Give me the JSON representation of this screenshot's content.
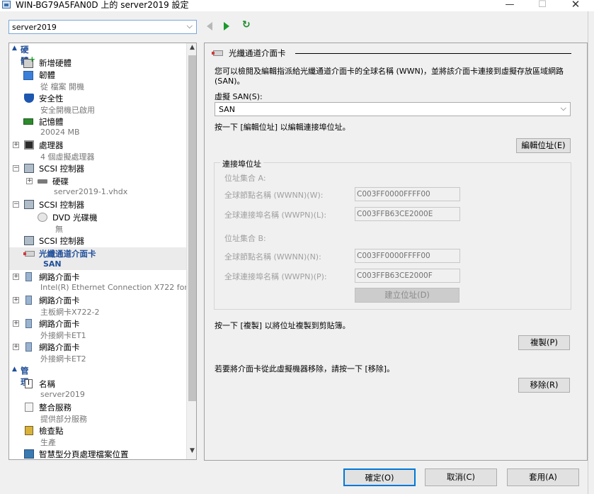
{
  "window": {
    "title": "WIN-BG79A5FAN0D 上的 server2019 設定",
    "min_glyph": "—",
    "max_glyph": "☐",
    "close_glyph": "✕"
  },
  "vm_select": {
    "value": "server2019",
    "arrow": "⌵"
  },
  "toolbar": {
    "back_icon": "back-arrow-icon",
    "forward_icon": "forward-arrow-icon",
    "refresh_glyph": "↻"
  },
  "tree": {
    "sections": {
      "hardware": "硬體",
      "management": "管理"
    },
    "items": [
      {
        "label": "新增硬體",
        "sub": ""
      },
      {
        "label": "韌體",
        "sub": "從 檔案 開機"
      },
      {
        "label": "安全性",
        "sub": "安全開機已啟用"
      },
      {
        "label": "記憶體",
        "sub": "20024 MB"
      },
      {
        "label": "處理器",
        "sub": "4 個虛擬處理器"
      },
      {
        "label": "SCSI 控制器",
        "sub": ""
      },
      {
        "label": "硬碟",
        "sub": "server2019-1.vhdx"
      },
      {
        "label": "SCSI 控制器",
        "sub": ""
      },
      {
        "label": "DVD 光碟機",
        "sub": "無"
      },
      {
        "label": "SCSI 控制器",
        "sub": ""
      },
      {
        "label": "光纖通道介面卡",
        "sub": "SAN"
      },
      {
        "label": "網路介面卡",
        "sub": "Intel(R) Ethernet Connection X722 for ..."
      },
      {
        "label": "網路介面卡",
        "sub": "主板網卡X722-2"
      },
      {
        "label": "網路介面卡",
        "sub": "外接網卡ET1"
      },
      {
        "label": "網路介面卡",
        "sub": "外接網卡ET2"
      },
      {
        "label": "名稱",
        "sub": "server2019"
      },
      {
        "label": "整合服務",
        "sub": "提供部分服務"
      },
      {
        "label": "檢查點",
        "sub": "生產"
      },
      {
        "label": "智慧型分頁處理檔案位置",
        "sub": ""
      }
    ]
  },
  "panel": {
    "title": "光纖通道介面卡",
    "description": "您可以檢閱及編輯指派給光纖通道介面卡的全球名稱 (WWN)，並將該介面卡連接到虛擬存放區域網路 (SAN)。",
    "san_label": "虛擬 SAN(S):",
    "san_value": "SAN",
    "edit_hint": "按一下 [編輯位址] 以編輯連接埠位址。",
    "edit_button": "編輯位址(E)",
    "group_title": "連接埠位址",
    "set_a": "位址集合 A:",
    "set_b": "位址集合 B:",
    "wwnn_a_label": "全球節點名稱 (WWNN)(W):",
    "wwpn_a_label": "全球連接埠名稱 (WWPN)(L):",
    "wwnn_b_label": "全球節點名稱 (WWNN)(N):",
    "wwpn_b_label": "全球連接埠名稱 (WWPN)(P):",
    "wwnn_a": "C003FF0000FFFF00",
    "wwpn_a": "C003FFB63CE2000E",
    "wwnn_b": "C003FF0000FFFF00",
    "wwpn_b": "C003FFB63CE2000F",
    "create_button": "建立位址(D)",
    "copy_hint": "按一下 [複製] 以將位址複製到剪貼簿。",
    "copy_button": "複製(P)",
    "remove_hint": "若要將介面卡從此虛擬機器移除，請按一下 [移除]。",
    "remove_button": "移除(R)"
  },
  "footer": {
    "ok": "確定(O)",
    "cancel": "取消(C)",
    "apply": "套用(A)"
  }
}
